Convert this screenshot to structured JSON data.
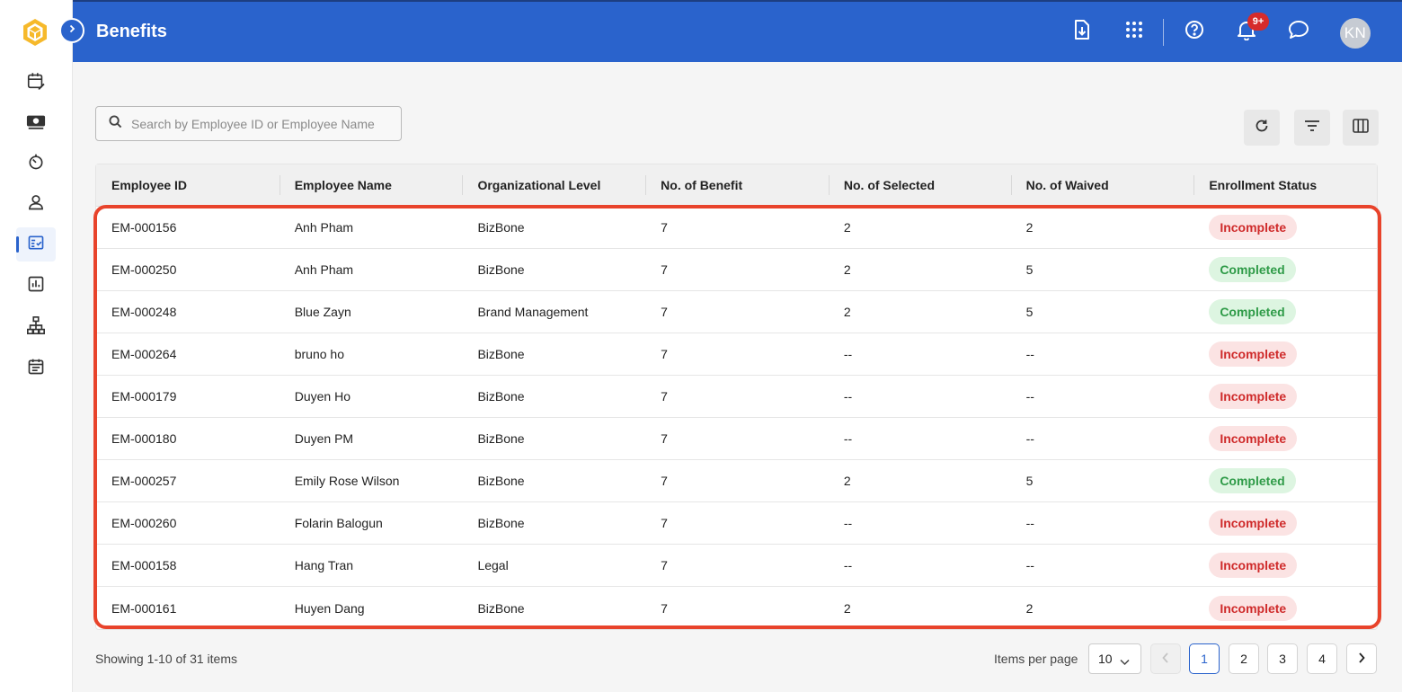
{
  "app": {
    "title": "Benefits"
  },
  "header": {
    "notification_badge": "9+",
    "avatar_initials": "KN",
    "icons": [
      "download-file-icon",
      "apps-grid-icon",
      "help-icon",
      "bell-icon",
      "chat-icon"
    ]
  },
  "sidebar": {
    "items": [
      {
        "icon": "calendar-edit-icon"
      },
      {
        "icon": "payroll-icon"
      },
      {
        "icon": "timer-icon"
      },
      {
        "icon": "person-icon"
      },
      {
        "icon": "benefits-checklist-icon",
        "active": true
      },
      {
        "icon": "report-chart-icon"
      },
      {
        "icon": "org-chart-icon"
      },
      {
        "icon": "schedule-icon"
      }
    ]
  },
  "search": {
    "placeholder": "Search by Employee ID or Employee Name",
    "value": ""
  },
  "table": {
    "columns": [
      "Employee ID",
      "Employee Name",
      "Organizational Level",
      "No. of Benefit",
      "No. of Selected",
      "No. of Waived",
      "Enrollment Status"
    ],
    "rows": [
      {
        "id": "EM-000156",
        "name": "Anh Pham",
        "org": "BizBone",
        "benefit": "7",
        "selected": "2",
        "waived": "2",
        "status": "Incomplete"
      },
      {
        "id": "EM-000250",
        "name": "Anh Pham",
        "org": "BizBone",
        "benefit": "7",
        "selected": "2",
        "waived": "5",
        "status": "Completed"
      },
      {
        "id": "EM-000248",
        "name": "Blue Zayn",
        "org": "Brand Management",
        "benefit": "7",
        "selected": "2",
        "waived": "5",
        "status": "Completed"
      },
      {
        "id": "EM-000264",
        "name": "bruno ho",
        "org": "BizBone",
        "benefit": "7",
        "selected": "--",
        "waived": "--",
        "status": "Incomplete"
      },
      {
        "id": "EM-000179",
        "name": "Duyen Ho",
        "org": "BizBone",
        "benefit": "7",
        "selected": "--",
        "waived": "--",
        "status": "Incomplete"
      },
      {
        "id": "EM-000180",
        "name": "Duyen PM",
        "org": "BizBone",
        "benefit": "7",
        "selected": "--",
        "waived": "--",
        "status": "Incomplete"
      },
      {
        "id": "EM-000257",
        "name": "Emily Rose Wilson",
        "org": "BizBone",
        "benefit": "7",
        "selected": "2",
        "waived": "5",
        "status": "Completed"
      },
      {
        "id": "EM-000260",
        "name": "Folarin Balogun",
        "org": "BizBone",
        "benefit": "7",
        "selected": "--",
        "waived": "--",
        "status": "Incomplete"
      },
      {
        "id": "EM-000158",
        "name": "Hang Tran",
        "org": "Legal",
        "benefit": "7",
        "selected": "--",
        "waived": "--",
        "status": "Incomplete"
      },
      {
        "id": "EM-000161",
        "name": "Huyen Dang",
        "org": "BizBone",
        "benefit": "7",
        "selected": "2",
        "waived": "2",
        "status": "Incomplete"
      }
    ]
  },
  "footer": {
    "showing": "Showing 1-10 of 31 items",
    "items_per_page_label": "Items per page",
    "items_per_page": "10",
    "pages": [
      "1",
      "2",
      "3",
      "4"
    ],
    "current_page": "1"
  },
  "colors": {
    "header_bg": "#2a63cc",
    "incomplete_text": "#cf2b2b",
    "incomplete_bg": "#fbe3e3",
    "completed_text": "#2f9b48",
    "completed_bg": "#ddf5e1",
    "highlight_border": "#e8432b"
  }
}
